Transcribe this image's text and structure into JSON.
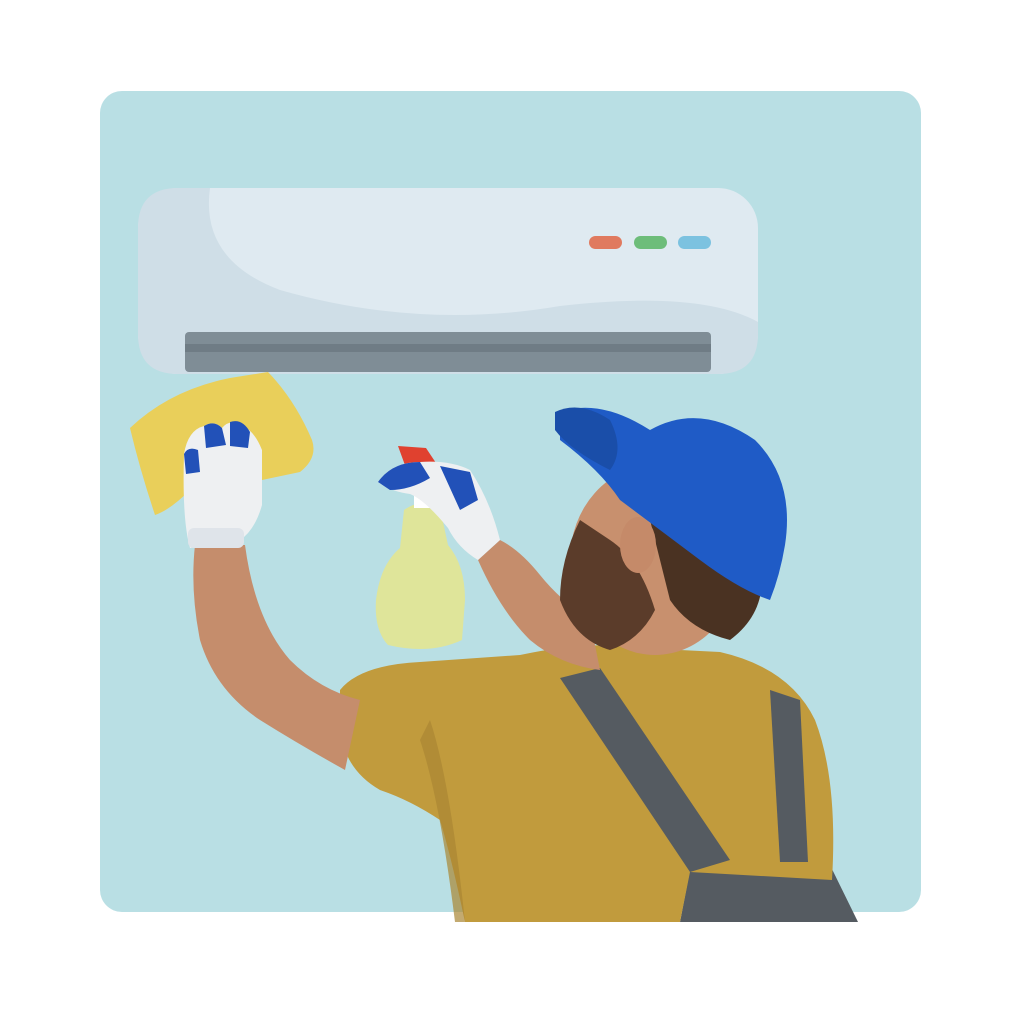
{
  "scene": {
    "background_color": "#b9dfe4",
    "ac_unit": {
      "body_color": "#dfeaf1",
      "shade_color": "#cfdee7",
      "vent_color": "#7f8d96",
      "indicator_lights": [
        {
          "name": "red-light",
          "color": "#e07a5f"
        },
        {
          "name": "green-light",
          "color": "#6dbd7a"
        },
        {
          "name": "blue-light",
          "color": "#7cc2e0"
        }
      ]
    },
    "worker": {
      "cap_color": "#1f5bc6",
      "shirt_color": "#c19b3d",
      "overalls_color": "#555b61",
      "glove_color": "#eef0f2",
      "glove_accent_color": "#2251b8",
      "cloth_color": "#e9cf5a",
      "spray_bottle_color": "#dfe59a",
      "spray_trigger_color": "#e0412f"
    }
  }
}
